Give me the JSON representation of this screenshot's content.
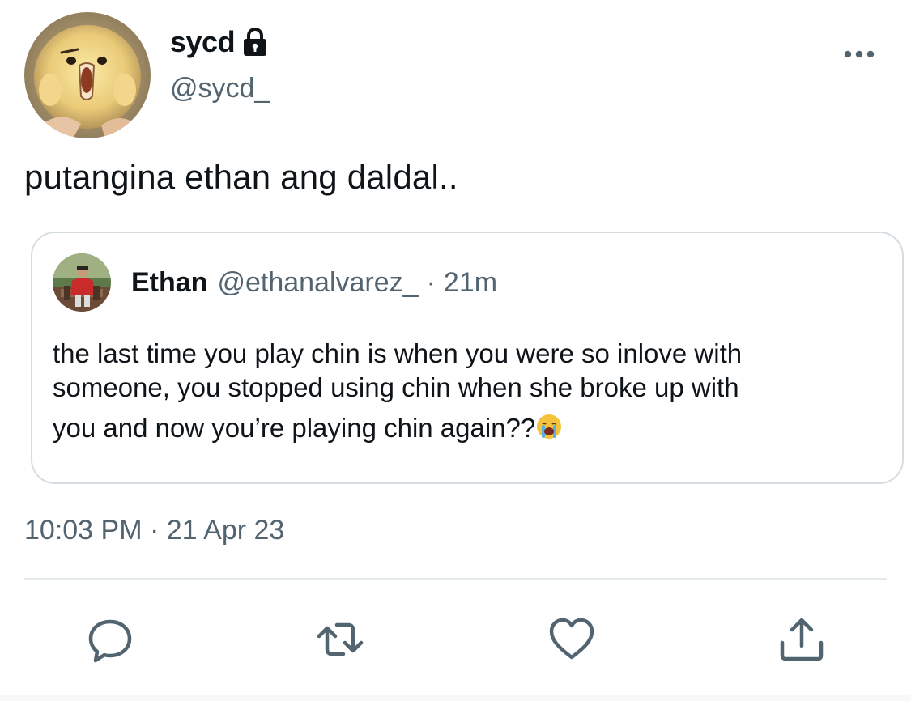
{
  "tweet": {
    "author": {
      "display_name": "sycd",
      "handle": "@sycd_",
      "protected_icon": "lock-icon",
      "avatar": "chick-avatar"
    },
    "more_icon": "more-horizontal-icon",
    "text": "putangina ethan ang daldal..",
    "quoted": {
      "author_name": "Ethan",
      "author_handle": "@ethanalvarez_",
      "separator": "·",
      "time_ago": "21m",
      "text_lines": [
        "the last time you play chin is when you were so inlove with",
        "someone, you stopped using chin when she broke up with",
        "you and now you’re playing chin again??"
      ],
      "emoji": "loudly-crying-face-icon"
    },
    "time": "10:03 PM",
    "date_separator": "·",
    "date": "21 Apr 23",
    "actions": [
      {
        "name": "reply",
        "icon": "reply-icon"
      },
      {
        "name": "retweet",
        "icon": "retweet-icon"
      },
      {
        "name": "like",
        "icon": "heart-icon"
      },
      {
        "name": "share",
        "icon": "share-icon"
      }
    ]
  },
  "colors": {
    "primary_text": "#0f1419",
    "secondary_text": "#536471",
    "border": "#d6dde2",
    "divider": "#e4e9ec",
    "background": "#ffffff"
  }
}
